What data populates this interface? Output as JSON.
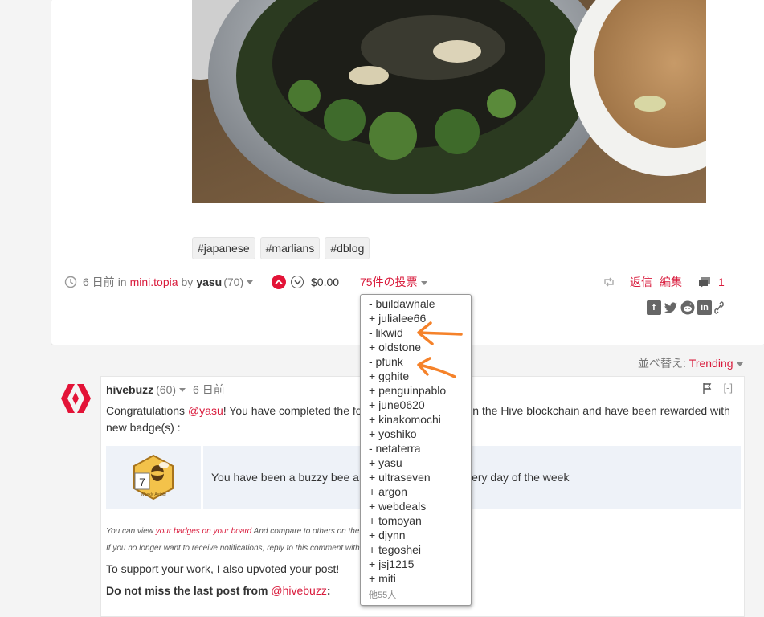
{
  "post": {
    "tags": [
      "#japanese",
      "#marlians",
      "#dblog"
    ],
    "meta": {
      "time": "6 日前",
      "in_word": "in",
      "community": "mini.topia",
      "by_word": "by",
      "author": "yasu",
      "reputation": "(70)"
    },
    "payout": "$0.00",
    "votes_label": "75件の投票",
    "reply_label": "返信",
    "edit_label": "編集",
    "comment_count": "1"
  },
  "votes_dropdown": {
    "voters": [
      "- buildawhale",
      "+ julialee66",
      "- likwid",
      "+ oldstone",
      "- pfunk",
      "+ gghite",
      "+ penguinpablo",
      "+ june0620",
      "+ kinakomochi",
      "+ yoshiko",
      "- netaterra",
      "+ yasu",
      "+ ultraseven",
      "+ argon",
      "+ webdeals",
      "+ tomoyan",
      "+ djynn",
      "+ tegoshei",
      "+ jsj1215",
      "+ miti"
    ],
    "more": "他55人"
  },
  "sort": {
    "label": "並べ替え:",
    "value": "Trending"
  },
  "comment": {
    "author": "hivebuzz",
    "reputation": "(60)",
    "time": "6 日前",
    "collapse": "[-]",
    "congrats_pre": "Congratulations ",
    "mention": "@yasu",
    "congrats_post": "! You have completed the following achievement on the Hive blockchain and have been rewarded with new badge(s) :",
    "badge_text": "You have been a buzzy bee and published a post every day of the week",
    "badge_number": "7",
    "badge_caption": "Weekly Author",
    "note1_pre": "You can view ",
    "note1_link": "your badges on your board",
    "note1_post": " And compare to others on the Ranking",
    "note2": "If you no longer want to receive notifications, reply to this comment with the word STOP",
    "support": "To support your work, I also upvoted your post!",
    "last_post_pre": "Do not miss the last post from ",
    "last_post_mention": "@hivebuzz",
    "last_post_post": ":"
  },
  "colors": {
    "accent": "#d91b3c",
    "annotation_arrow": "#f5822a"
  }
}
